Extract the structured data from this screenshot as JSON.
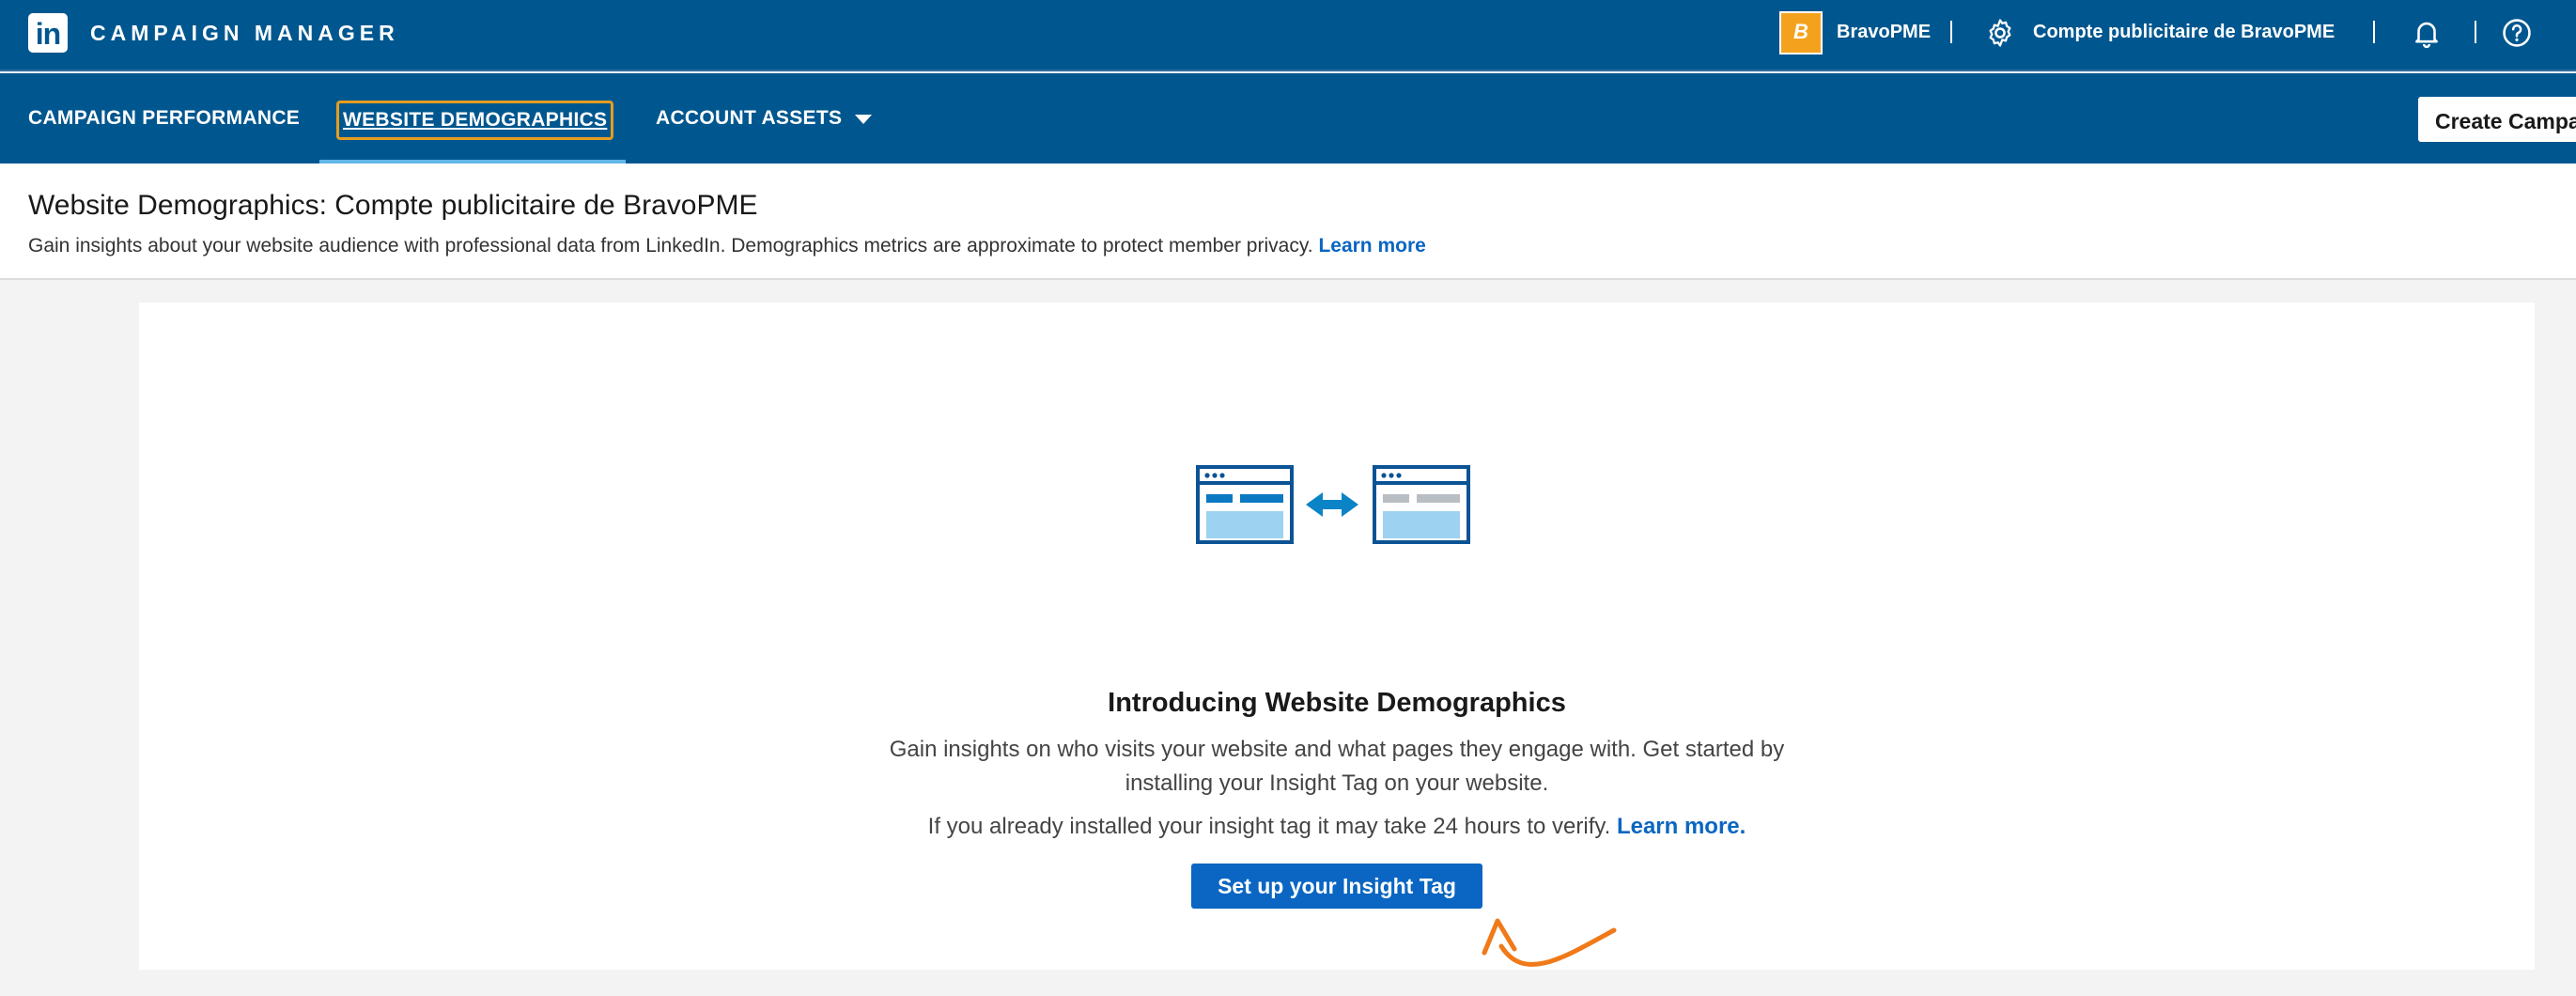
{
  "topbar": {
    "app_title": "CAMPAIGN MANAGER",
    "logo_text": "in",
    "account_initial": "B",
    "account_name": "BravoPME",
    "ad_account_label": "Compte publicitaire de BravoPME",
    "icons": [
      "linkedin-logo-icon",
      "gear-icon",
      "bell-icon",
      "help-icon"
    ]
  },
  "nav": {
    "campaign_performance": "CAMPAIGN PERFORMANCE",
    "website_demographics": "WEBSITE DEMOGRAPHICS",
    "account_assets": "ACCOUNT ASSETS",
    "create_campaign": "Create Campaign"
  },
  "header": {
    "title": "Website Demographics: Compte publicitaire de BravoPME",
    "subtitle": "Gain insights about your website audience with professional data from LinkedIn. Demographics metrics are approximate to protect member privacy.",
    "learn_more": "Learn more"
  },
  "main": {
    "intro_title": "Introducing Website Demographics",
    "description": "Gain insights on who visits your website and what pages they engage with. Get started by installing your Insight Tag on your website.",
    "verify_text": "If you already installed your insight tag it may take 24 hours to verify.",
    "verify_link": "Learn more.",
    "cta_label": "Set up your Insight Tag"
  },
  "colors": {
    "brand_blue": "#00578f",
    "link_blue": "#0a66c2",
    "focus_orange": "#e69d1f",
    "annotation_orange": "#f07a1a"
  }
}
